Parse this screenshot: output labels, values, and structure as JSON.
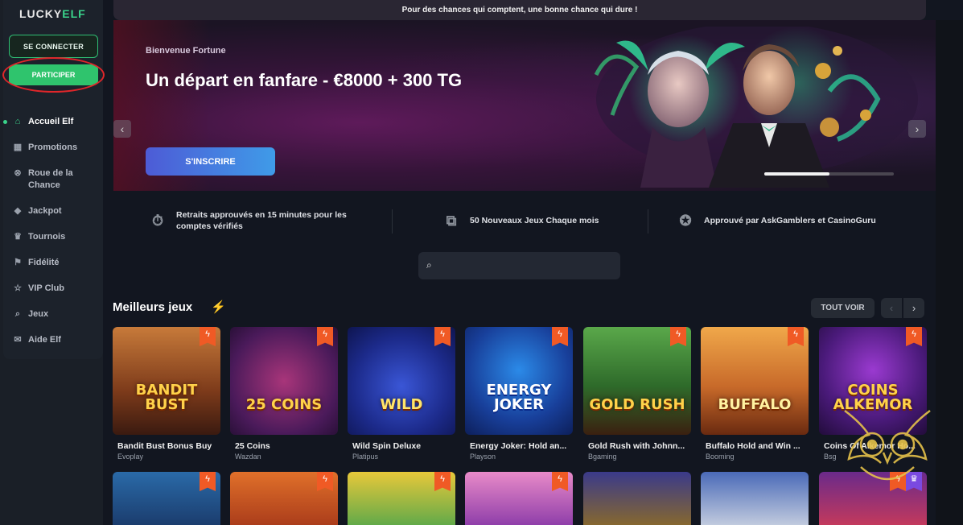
{
  "brand": {
    "logo_left": "LUCKY",
    "logo_right": "ELF"
  },
  "auth": {
    "login_label": "SE CONNECTER",
    "join_label": "PARTICIPER"
  },
  "sidebar": {
    "items": [
      {
        "label": "Accueil Elf",
        "icon": "home-icon"
      },
      {
        "label": "Promotions",
        "icon": "gift-icon"
      },
      {
        "label": "Roue de la Chance",
        "icon": "wheel-icon"
      },
      {
        "label": "Jackpot",
        "icon": "diamond-icon"
      },
      {
        "label": "Tournois",
        "icon": "trophy-icon"
      },
      {
        "label": "Fidélité",
        "icon": "flag-icon"
      },
      {
        "label": "VIP Club",
        "icon": "star-icon"
      },
      {
        "label": "Jeux",
        "icon": "search-icon"
      },
      {
        "label": "Aide Elf",
        "icon": "chat-icon"
      }
    ]
  },
  "promo_bar": {
    "text": "Pour des chances qui comptent, une bonne chance qui dure !"
  },
  "hero": {
    "subtitle": "Bienvenue Fortune",
    "title": "Un départ en fanfare - €8000 + 300 TG",
    "cta_label": "S'INSCRIRE",
    "slide_progress": 0.5
  },
  "features": [
    {
      "text": "Retraits approuvés en 15 minutes pour les comptes vérifiés",
      "icon": "stopwatch-icon"
    },
    {
      "text": "50 Nouveaux Jeux Chaque mois",
      "icon": "dice-icon"
    },
    {
      "text": "Approuvé par AskGamblers et CasinoGuru",
      "icon": "award-icon"
    }
  ],
  "games_section": {
    "title": "Meilleurs jeux",
    "see_all_label": "TOUT VOIR"
  },
  "games": [
    {
      "name": "Bandit Bust Bonus Buy",
      "provider": "Evoplay",
      "art": "BANDIT BUST"
    },
    {
      "name": "25 Coins",
      "provider": "Wazdan",
      "art": "25 COINS"
    },
    {
      "name": "Wild Spin Deluxe",
      "provider": "Platipus",
      "art": "WILD"
    },
    {
      "name": "Energy Joker: Hold an...",
      "provider": "Playson",
      "art": "ENERGY JOKER"
    },
    {
      "name": "Gold Rush with Johnn...",
      "provider": "Bgaming",
      "art": "GOLD RUSH"
    },
    {
      "name": "Buffalo Hold and Win ...",
      "provider": "Booming",
      "art": "BUFFALO"
    },
    {
      "name": "Coins Of Alkemor Ho...",
      "provider": "Bsg",
      "art": "COINS ALKEMOR"
    }
  ],
  "colors": {
    "accent_green": "#2fc46d",
    "badge_orange": "#f05a25",
    "cta_blue": "#4d5bd6",
    "annotation_red": "#e0262a"
  }
}
